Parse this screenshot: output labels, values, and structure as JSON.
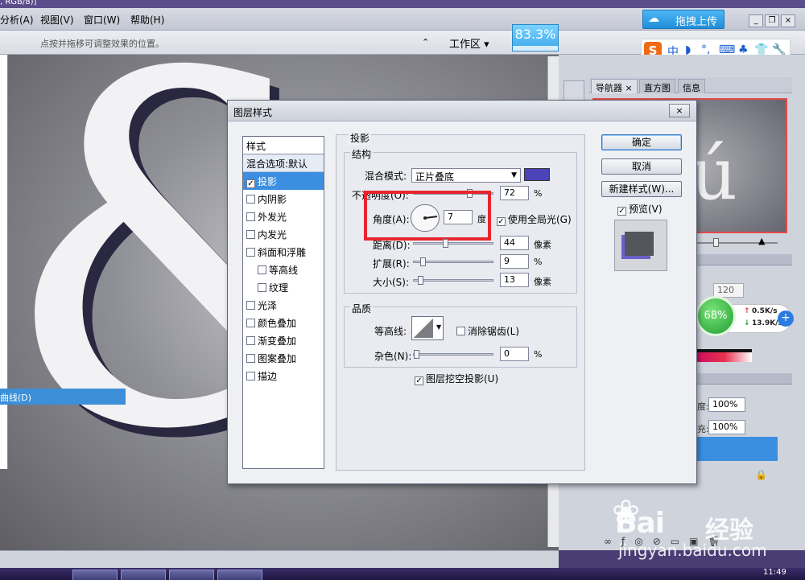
{
  "window": {
    "title_fragment": ", RGB/8)]"
  },
  "menu": {
    "items": [
      "分析(A)",
      "视图(V)",
      "窗口(W)",
      "帮助(H)"
    ]
  },
  "options": {
    "hint": "点按并拖移可调整效果的位置。",
    "workspace_label": "工作区 ▾",
    "zoom": "83.3%"
  },
  "upload": {
    "label": "拖拽上传"
  },
  "ime": {
    "logo": "S",
    "chars": [
      "中",
      "◗",
      "°,",
      "⌨",
      "♣",
      "👕",
      "🔧"
    ]
  },
  "canvas": {
    "curves_item": "曲线(D)",
    "glyph": "&"
  },
  "navigator": {
    "tabs": [
      "导航器 ×",
      "直方图",
      "信息"
    ],
    "preview_glyph": "ú"
  },
  "colors": {
    "value_120": "120"
  },
  "layers": {
    "opacity_label": "度:",
    "opacity_value": "100%",
    "fill_label": "充:",
    "fill_value": "100%"
  },
  "net_widget": {
    "percent": "68%",
    "up": "0.5K/s",
    "down": "13.9K/s",
    "up_arrow": "↑",
    "down_arrow": "↓",
    "plus": "+"
  },
  "taskbar": {
    "clock": "11:49"
  },
  "watermark": {
    "brand": "Bai",
    "brand2": "经验",
    "url": "jingyan.baidu.com"
  },
  "dialog": {
    "title": "图层样式",
    "close": "×",
    "styles_list": [
      {
        "label": "样式",
        "kind": "header"
      },
      {
        "label": "混合选项:默认",
        "kind": "blend"
      },
      {
        "label": "投影",
        "kind": "active",
        "checked": true
      },
      {
        "label": "内阴影",
        "kind": "item",
        "checked": false
      },
      {
        "label": "外发光",
        "kind": "item",
        "checked": false
      },
      {
        "label": "内发光",
        "kind": "item",
        "checked": false
      },
      {
        "label": "斜面和浮雕",
        "kind": "item",
        "checked": false
      },
      {
        "label": "等高线",
        "kind": "sub",
        "checked": false
      },
      {
        "label": "纹理",
        "kind": "sub",
        "checked": false
      },
      {
        "label": "光泽",
        "kind": "item",
        "checked": false
      },
      {
        "label": "颜色叠加",
        "kind": "item",
        "checked": false
      },
      {
        "label": "渐变叠加",
        "kind": "item",
        "checked": false
      },
      {
        "label": "图案叠加",
        "kind": "item",
        "checked": false
      },
      {
        "label": "描边",
        "kind": "item",
        "checked": false
      }
    ],
    "section_title": "投影",
    "structure_title": "结构",
    "blend_mode_label": "混合模式:",
    "blend_mode_value": "正片叠底",
    "shadow_color": "#4b43b8",
    "opacity_label": "不透明度(O):",
    "opacity_value": "72",
    "opacity_unit": "%",
    "opacity_level": 0.72,
    "angle_label": "角度(A):",
    "angle_value": "7",
    "angle_unit": "度",
    "global_light_label": "使用全局光(G)",
    "global_light_checked": true,
    "distance_label": "距离(D):",
    "distance_value": "44",
    "distance_unit": "像素",
    "spread_label": "扩展(R):",
    "spread_value": "9",
    "spread_unit": "%",
    "size_label": "大小(S):",
    "size_value": "13",
    "size_unit": "像素",
    "quality_title": "品质",
    "contour_label": "等高线:",
    "antialias_label": "消除锯齿(L)",
    "noise_label": "杂色(N):",
    "noise_value": "0",
    "noise_unit": "%",
    "knockout_label": "图层挖空投影(U)",
    "ok_label": "确定",
    "cancel_label": "取消",
    "new_style_label": "新建样式(W)...",
    "preview_label": "预览(V)",
    "highlight_color": "#e8252d"
  }
}
